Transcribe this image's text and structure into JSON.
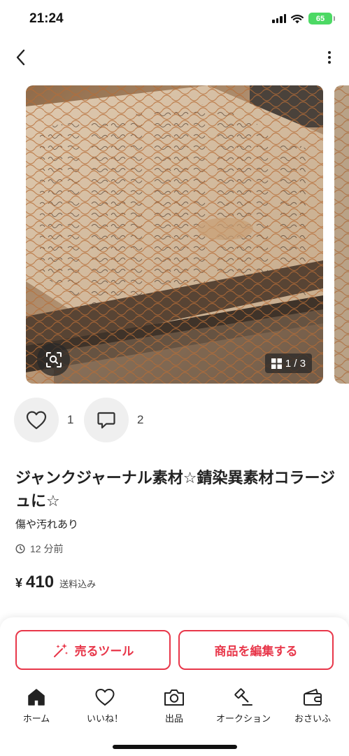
{
  "status_bar": {
    "time": "21:24",
    "battery": "65"
  },
  "item": {
    "photo_counter": "1 / 3",
    "like_count": "1",
    "comment_count": "2",
    "title": "ジャンクジャーナル素材☆錆染異素材コラージュに☆",
    "condition": "傷や汚れあり",
    "posted": "12 分前",
    "price_symbol": "¥",
    "price": "410",
    "shipping": "送料込み"
  },
  "actions": {
    "sell_tool": "売るツール",
    "edit_item": "商品を編集する"
  },
  "tabs": [
    {
      "label": "ホーム",
      "icon": "home-icon",
      "active": true
    },
    {
      "label": "いいね！",
      "icon": "heart-icon"
    },
    {
      "label": "出品",
      "icon": "camera-icon"
    },
    {
      "label": "オークション",
      "icon": "gavel-icon"
    },
    {
      "label": "おさいふ",
      "icon": "wallet-icon"
    }
  ],
  "colors": {
    "accent": "#e8374a",
    "battery": "#4cd964"
  }
}
